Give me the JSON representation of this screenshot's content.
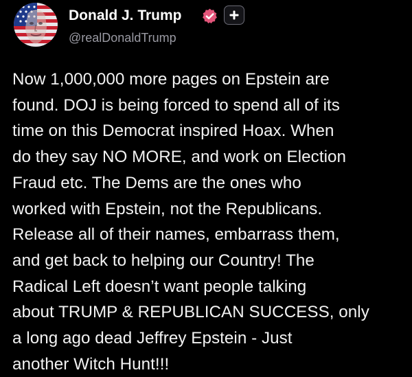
{
  "author": {
    "display_name": "Donald J. Trump",
    "handle": "@realDonaldTrump",
    "verified": true
  },
  "post": {
    "lines": [
      "Now 1,000,000 more pages on Epstein are",
      "found. DOJ is being forced to spend all of its",
      "time on this Democrat inspired Hoax. When",
      "do they say NO MORE, and work on Election",
      "Fraud etc. The Dems are the ones who",
      "worked with Epstein, not the Republicans.",
      "Release all of their names, embarrass them,",
      "and get back to helping our Country! The",
      "Radical Left doesn’t want people talking",
      "about TRUMP & REPUBLICAN SUCCESS, only",
      "a long ago dead Jeffrey Epstein - Just",
      "another Witch Hunt!!!"
    ]
  },
  "colors": {
    "background": "#000000",
    "verified_badge": "#e2557a",
    "handle_text": "#9a9aa3"
  },
  "icons": {
    "verified": "verified-badge-icon",
    "follow": "plus-icon"
  }
}
